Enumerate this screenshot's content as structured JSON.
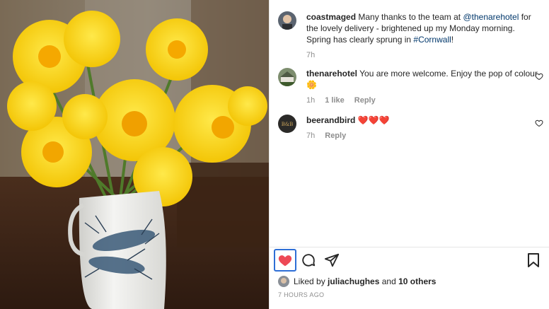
{
  "post": {
    "caption": {
      "username": "coastmaged",
      "text_1": " Many thanks to the team at ",
      "mention": "@thenarehotel",
      "text_2": " for the lovely delivery - brightened up my Monday morning. Spring has clearly sprung in ",
      "hashtag": "#Cornwall",
      "text_3": "!",
      "time": "7h"
    },
    "comments": [
      {
        "username": "thenarehotel",
        "text": " You are more welcome. Enjoy the pop of colour ",
        "emoji": "🌼",
        "time": "1h",
        "likes": "1 like",
        "reply": "Reply"
      },
      {
        "username": "beerandbird",
        "text": " ❤️❤️❤️",
        "time": "7h",
        "reply": "Reply"
      }
    ],
    "liked_by": {
      "prefix": "Liked by ",
      "user": "juliachughes",
      "middle": " and ",
      "others": "10 others"
    },
    "timestamp": "7 HOURS AGO"
  },
  "colors": {
    "like_red": "#ed4956",
    "link_blue": "#00376b",
    "focus_blue": "#2e6fd6",
    "daffodil": "#f5d000"
  },
  "icons": [
    "heart-icon",
    "comment-icon",
    "share-icon",
    "bookmark-icon",
    "comment-like-icon"
  ]
}
